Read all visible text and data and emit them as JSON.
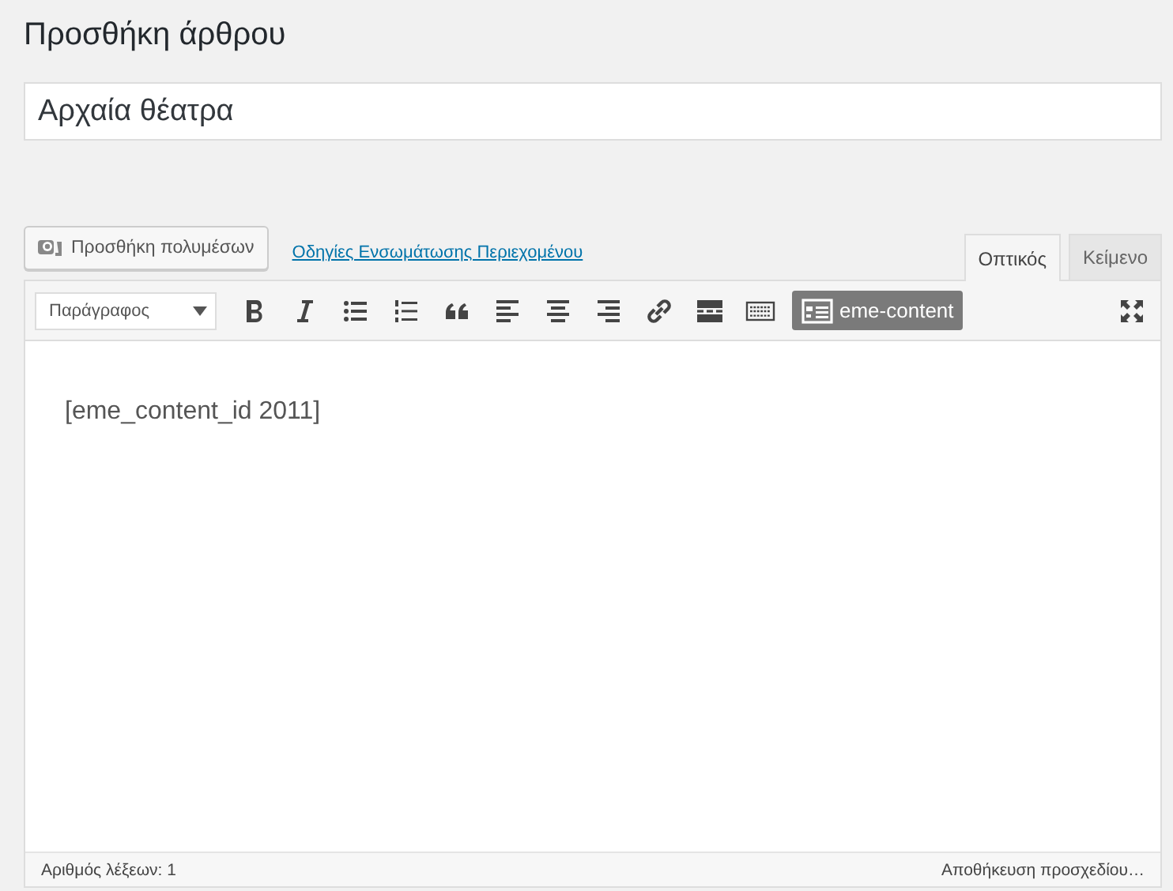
{
  "page_title": "Προσθήκη άρθρου",
  "post_title": {
    "value": "Αρχαία θέατρα"
  },
  "media_button": "Προσθήκη πολυμέσων",
  "help_link": "Οδηγίες Ενσωμάτωσης Περιεχομένου",
  "tabs": [
    {
      "label": "Οπτικός",
      "selected": true
    },
    {
      "label": "Κείμενο",
      "selected": false
    }
  ],
  "format_select": "Παράγραφος",
  "toolbar": [
    {
      "kind": "bold"
    },
    {
      "kind": "italic"
    },
    {
      "kind": "bullets"
    },
    {
      "kind": "numbers"
    },
    {
      "kind": "quote"
    },
    {
      "kind": "align-left"
    },
    {
      "kind": "align-center"
    },
    {
      "kind": "align-right"
    },
    {
      "kind": "link"
    },
    {
      "kind": "more"
    },
    {
      "kind": "keyboard"
    }
  ],
  "custom_button": "eme-content",
  "content": "[eme_content_id 2011]",
  "status_bar": {
    "word_count": "Αριθμός λέξεων: 1",
    "save_status": "Αποθήκευση προσχεδίου…"
  }
}
